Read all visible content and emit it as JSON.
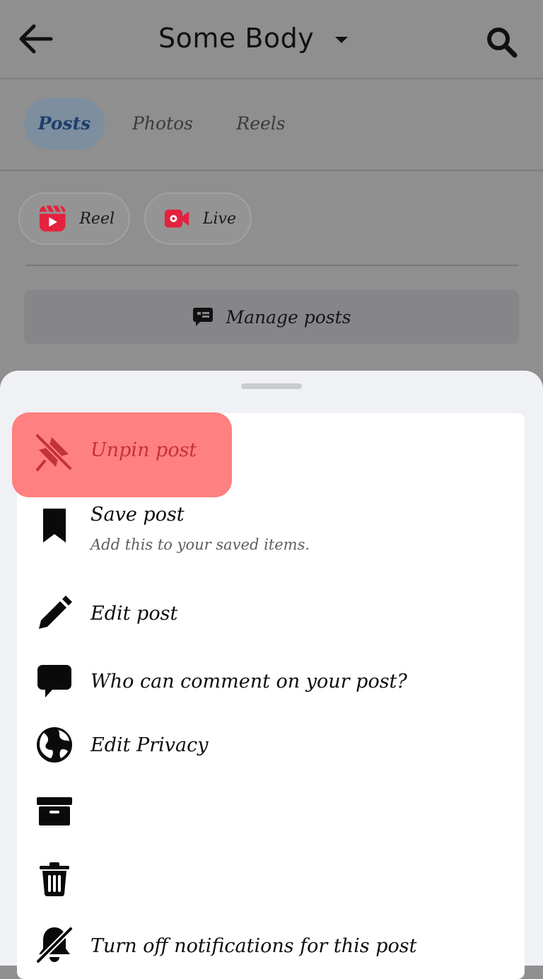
{
  "header": {
    "title": "Some Body",
    "back_icon": "arrow-left-icon",
    "search_icon": "search-icon"
  },
  "tabs": [
    {
      "label": "Posts",
      "active": true
    },
    {
      "label": "Photos",
      "active": false
    },
    {
      "label": "Reels",
      "active": false
    }
  ],
  "create": {
    "reel_label": "Reel",
    "live_label": "Live",
    "manage_label": "Manage posts"
  },
  "sheet": {
    "items": [
      {
        "label": "Unpin post",
        "icon": "unpin-icon",
        "highlighted": true
      },
      {
        "label": "Save post",
        "sublabel": "Add this to your saved items.",
        "icon": "bookmark-icon"
      },
      {
        "label": "Edit post",
        "icon": "pencil-icon"
      },
      {
        "label": "Who can comment on your post?",
        "icon": "comment-icon"
      },
      {
        "label": "Edit Privacy",
        "icon": "globe-icon"
      },
      {
        "label": "",
        "icon": "archive-icon"
      },
      {
        "label": "",
        "icon": "trash-icon"
      },
      {
        "label": "Turn off notifications for this post",
        "icon": "bell-off-icon"
      }
    ]
  },
  "colors": {
    "overlay": "#8f8f8f",
    "highlight": "#ff8080",
    "unpin_text": "#c4313a",
    "accent_tab": "#1e3f6a",
    "reel_red": "#e4223f"
  }
}
